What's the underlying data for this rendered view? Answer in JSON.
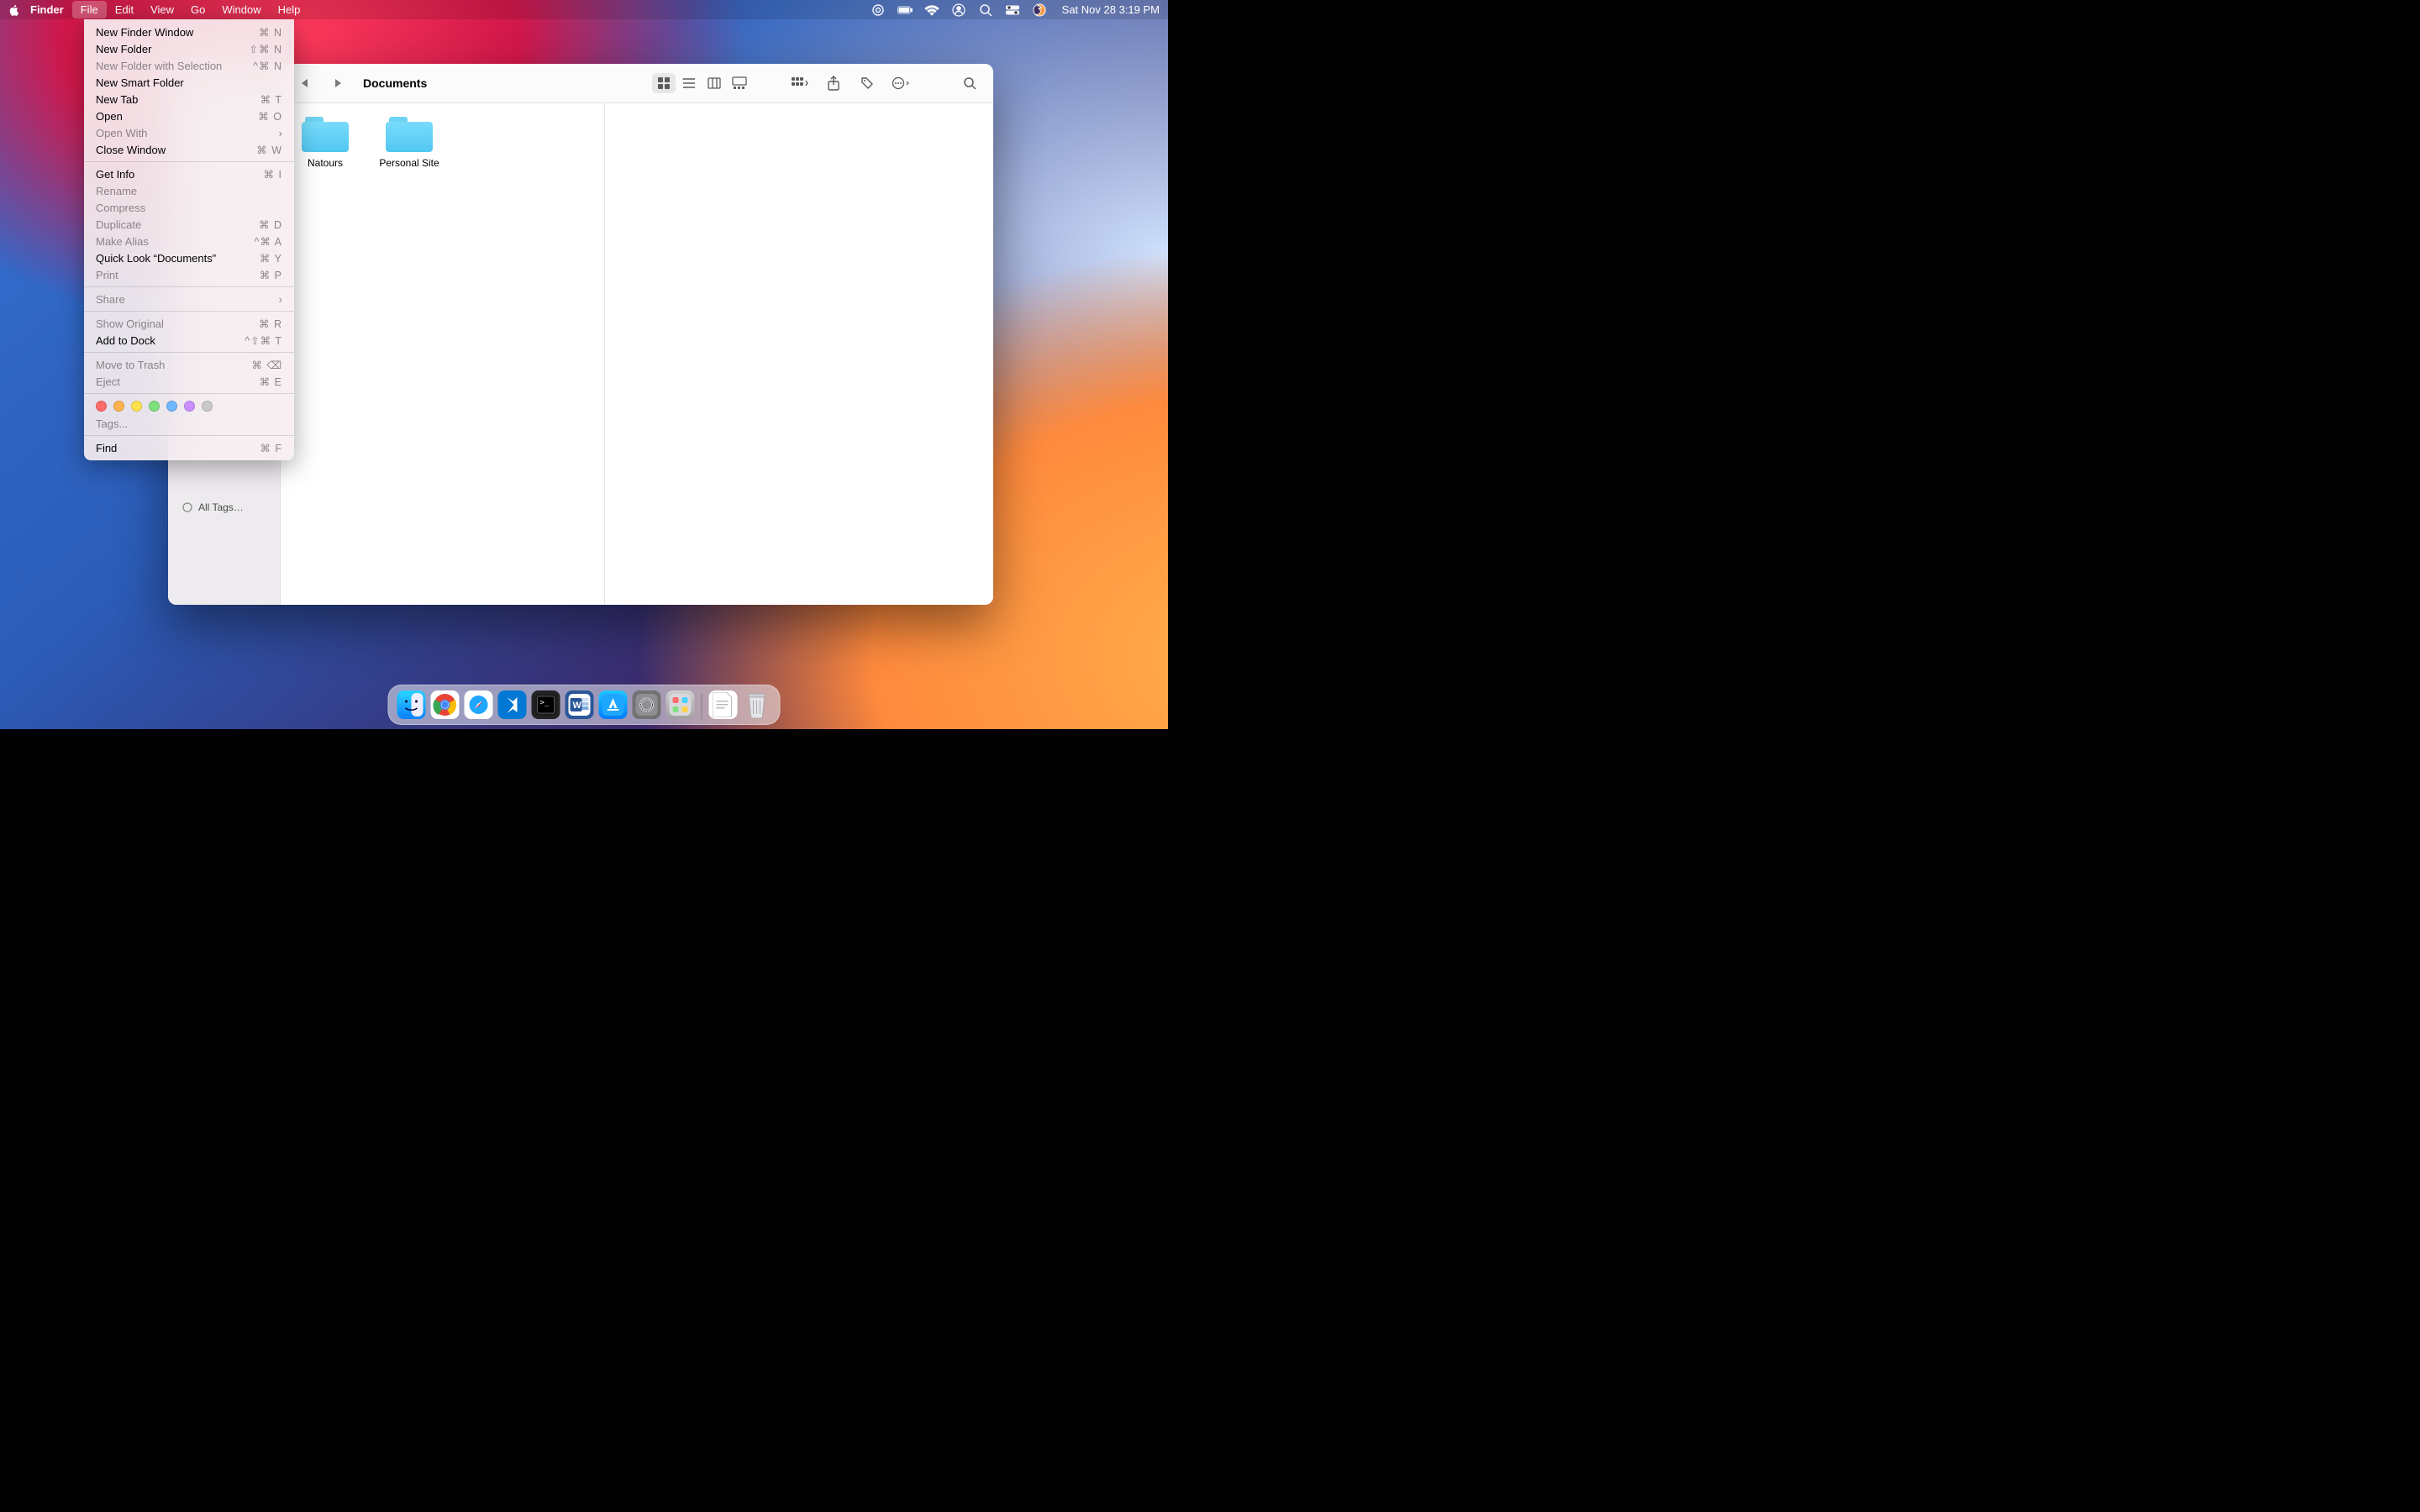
{
  "menubar": {
    "app_name": "Finder",
    "items": [
      "File",
      "Edit",
      "View",
      "Go",
      "Window",
      "Help"
    ],
    "datetime": "Sat Nov 28  3:19 PM"
  },
  "file_menu": {
    "items": [
      {
        "label": "New Finder Window",
        "shortcut": "⌘ N",
        "disabled": false
      },
      {
        "label": "New Folder",
        "shortcut": "⇧⌘ N",
        "disabled": false
      },
      {
        "label": "New Folder with Selection",
        "shortcut": "^⌘ N",
        "disabled": true
      },
      {
        "label": "New Smart Folder",
        "shortcut": "",
        "disabled": false
      },
      {
        "label": "New Tab",
        "shortcut": "⌘ T",
        "disabled": false
      },
      {
        "label": "Open",
        "shortcut": "⌘ O",
        "disabled": false
      },
      {
        "label": "Open With",
        "shortcut": "",
        "disabled": true,
        "submenu": true
      },
      {
        "label": "Close Window",
        "shortcut": "⌘ W",
        "disabled": false
      }
    ],
    "items2": [
      {
        "label": "Get Info",
        "shortcut": "⌘ I",
        "disabled": false
      },
      {
        "label": "Rename",
        "shortcut": "",
        "disabled": true
      },
      {
        "label": "Compress",
        "shortcut": "",
        "disabled": true
      },
      {
        "label": "Duplicate",
        "shortcut": "⌘ D",
        "disabled": true
      },
      {
        "label": "Make Alias",
        "shortcut": "^⌘ A",
        "disabled": true
      },
      {
        "label": "Quick Look “Documents”",
        "shortcut": "⌘ Y",
        "disabled": false
      },
      {
        "label": "Print",
        "shortcut": "⌘ P",
        "disabled": true
      }
    ],
    "items3": [
      {
        "label": "Share",
        "shortcut": "",
        "disabled": true,
        "submenu": true
      }
    ],
    "items4": [
      {
        "label": "Show Original",
        "shortcut": "⌘ R",
        "disabled": true
      },
      {
        "label": "Add to Dock",
        "shortcut": "^⇧⌘ T",
        "disabled": false
      }
    ],
    "items5": [
      {
        "label": "Move to Trash",
        "shortcut": "⌘ ⌫",
        "disabled": true
      },
      {
        "label": "Eject",
        "shortcut": "⌘ E",
        "disabled": true
      }
    ],
    "tag_colors": [
      "#ff6b6b",
      "#ffb24d",
      "#ffe14d",
      "#7fe07f",
      "#6fb8ff",
      "#c98fff",
      "#c9c9c9"
    ],
    "items6": [
      {
        "label": "Tags...",
        "shortcut": "",
        "disabled": true
      }
    ],
    "items7": [
      {
        "label": "Find",
        "shortcut": "⌘ F",
        "disabled": false
      }
    ]
  },
  "finder": {
    "title": "Documents",
    "sidebar_extra": "All Tags…",
    "folders": [
      {
        "name": "Natours"
      },
      {
        "name": "Personal Site"
      }
    ]
  },
  "dock": {
    "apps": [
      {
        "name": "Finder",
        "bg": "linear-gradient(#29d0ff,#0a84ff)"
      },
      {
        "name": "Chrome",
        "bg": "#fff"
      },
      {
        "name": "Safari",
        "bg": "#fff"
      },
      {
        "name": "VS Code",
        "bg": "#0078d4"
      },
      {
        "name": "Terminal",
        "bg": "#222"
      },
      {
        "name": "Word",
        "bg": "#2b579a"
      },
      {
        "name": "App Store",
        "bg": "linear-gradient(#1ec7ff,#007aff)"
      },
      {
        "name": "System Preferences",
        "bg": "#727272"
      },
      {
        "name": "Launchpad",
        "bg": "linear-gradient(#d0d0d0,#a0a0a0)"
      }
    ],
    "right": [
      {
        "name": "Document",
        "bg": "#fff"
      },
      {
        "name": "Trash",
        "bg": "transparent"
      }
    ]
  }
}
